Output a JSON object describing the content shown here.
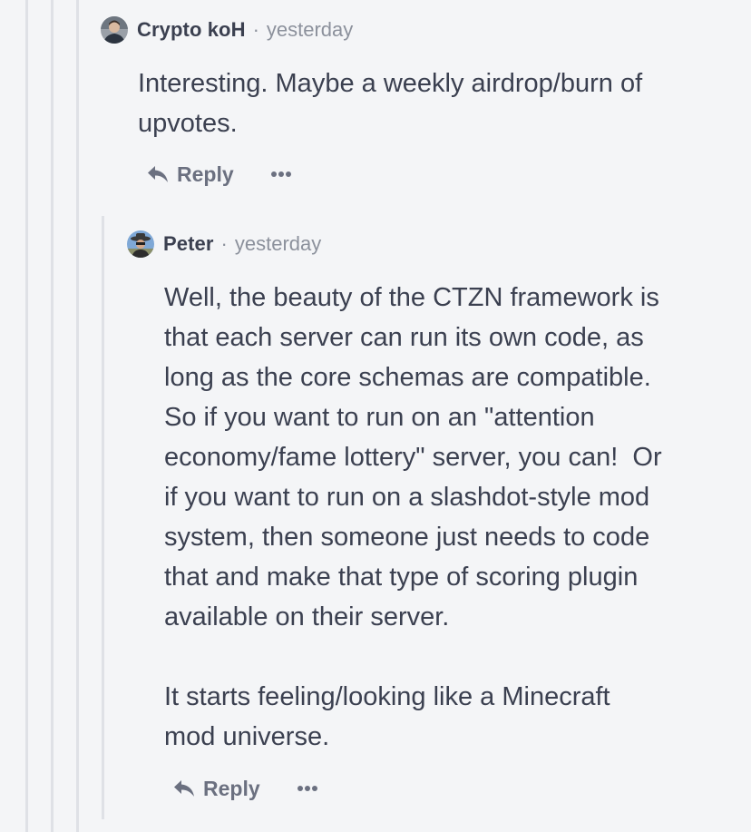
{
  "comments": [
    {
      "author": "Crypto koH",
      "separator": "·",
      "time": "yesterday",
      "body": "Interesting. Maybe a weekly airdrop/burn of\nupvotes.",
      "reply_label": "Reply",
      "avatar_icon": "user-avatar-photo"
    },
    {
      "author": "Peter",
      "separator": "·",
      "time": "yesterday",
      "body": "Well, the beauty of the CTZN framework is\nthat each server can run its own code, as\nlong as the core schemas are compatible.\nSo if you want to run on an \"attention\neconomy/fame lottery\" server, you can!  Or\nif you want to run on a slashdot-style mod\nsystem, then someone just needs to code\nthat and make that type of scoring plugin\navailable on their server.\n\nIt starts feeling/looking like a Minecraft\nmod universe.",
      "reply_label": "Reply",
      "avatar_icon": "user-avatar-photo"
    }
  ],
  "colors": {
    "background": "#f4f5f7",
    "thread_line": "#dfe1e6",
    "text": "#3b4050",
    "muted": "#8c919c",
    "action": "#6b7080"
  }
}
